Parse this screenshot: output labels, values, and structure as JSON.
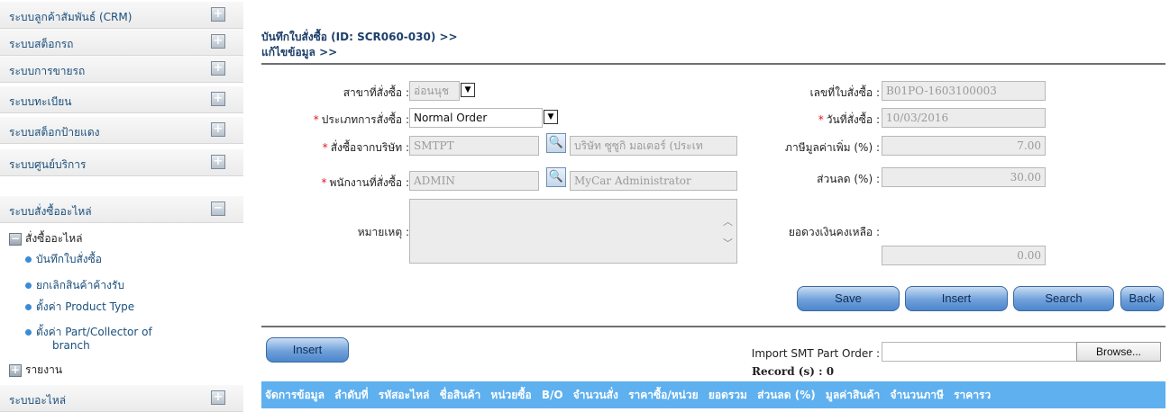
{
  "sidebar": {
    "menu": [
      {
        "label": "ระบบลูกค้าสัมพันธ์ (CRM)",
        "state": "+"
      },
      {
        "label": "ระบบสต็อกรถ",
        "state": "+"
      },
      {
        "label": "ระบบการขายรถ",
        "state": "+"
      },
      {
        "label": "ระบบทะเบียน",
        "state": "+"
      },
      {
        "label": "ระบบสต็อกป้ายแดง",
        "state": "+"
      },
      {
        "label": "ระบบศูนย์บริการ",
        "state": "+"
      },
      {
        "label": "ระบบสั่งซื้ออะไหล่",
        "state": "−"
      }
    ],
    "submenu_head": {
      "label": "สั่งซื้ออะไหล่",
      "state": "−"
    },
    "sub_items": [
      "บันทึกใบสั่งซื้อ",
      "ยกเลิกสินค้าค้างรับ",
      "ตั้งค่า Product Type",
      "ตั้งค่า Part/Collector of",
      "branch"
    ],
    "report": {
      "label": "รายงาน",
      "state": "+"
    },
    "last": {
      "label": "ระบบอะไหล่",
      "state": "+"
    }
  },
  "header": {
    "title_line1": "บันทึกใบสั่งซื้อ (ID: SCR060-030) >>",
    "title_line2": "แก้ไขข้อมูล >>"
  },
  "form": {
    "branch_label": "สาขาที่สั่งซื้อ :",
    "branch_value": "อ่อนนุช",
    "order_type_label": "ประเภทการสั่งซื้อ :",
    "order_type_value": "Normal Order",
    "supplier_label": "สั่งซื้อจากบริษัท :",
    "supplier_code": "SMTPT",
    "supplier_name": "บริษัท ซูซูกิ มอเตอร์ (ประเท",
    "employee_label": "พนักงานที่สั่งซื้อ :",
    "employee_code": "ADMIN",
    "employee_name": "MyCar Administrator",
    "remark_label": "หมายเหตุ :",
    "po_no_label": "เลขที่ใบสั่งซื้อ :",
    "po_no_value": "B01PO-1603100003",
    "date_label": "วันที่สั่งซื้อ :",
    "date_value": "10/03/2016",
    "vat_label": "ภาษีมูลค่าเพิ่ม (%) :",
    "vat_value": "7.00",
    "discount_label": "ส่วนลด (%) :",
    "discount_value": "30.00",
    "balance_label": "ยอดวงเงินคงเหลือ :",
    "balance_value": "0.00",
    "required_mark": "*"
  },
  "buttons": {
    "save": "Save",
    "insert": "Insert",
    "search": "Search",
    "back": "Back",
    "insert2": "Insert",
    "browse": "Browse..."
  },
  "import": {
    "label": "Import SMT Part Order :",
    "value": ""
  },
  "records": "Record (s) : 0",
  "table": {
    "columns": [
      "จัดการข้อมูล",
      "ลำดับที่",
      "รหัสอะไหล่",
      "ชื่อสินค้า",
      "หน่วยซื้อ",
      "B/O",
      "จำนวนสั่ง",
      "ราคาซื้อ/หน่วย",
      "ยอดรวม",
      "ส่วนลด (%)",
      "มูลค่าสินค้า",
      "จำนวนภาษี",
      "ราคารว"
    ]
  },
  "icons": {
    "expand": "plus-box-icon",
    "collapse": "minus-box-icon",
    "lookup": "magnifier-icon",
    "bullet": "bullet-dot-icon"
  }
}
